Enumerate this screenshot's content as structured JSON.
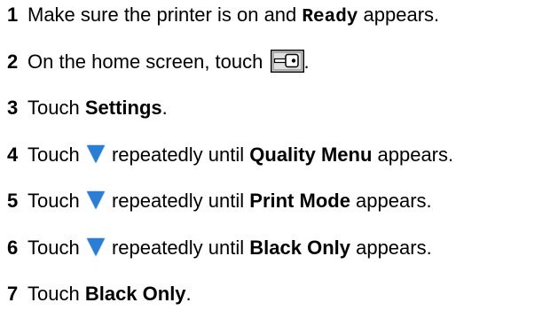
{
  "steps": [
    {
      "number": "1",
      "a": "Make sure the printer is on and ",
      "code": "Ready",
      "b": " appears."
    },
    {
      "number": "2",
      "a": "On the home screen, touch ",
      "icon": "settings-key-icon",
      "b": "."
    },
    {
      "number": "3",
      "a": "Touch ",
      "bold": "Settings",
      "b": "."
    },
    {
      "number": "4",
      "a": "Touch ",
      "icon": "down-arrow-icon",
      "mid": " repeatedly until ",
      "bold": "Quality Menu",
      "b": " appears."
    },
    {
      "number": "5",
      "a": "Touch ",
      "icon": "down-arrow-icon",
      "mid": " repeatedly until ",
      "bold": "Print Mode",
      "b": " appears."
    },
    {
      "number": "6",
      "a": "Touch ",
      "icon": "down-arrow-icon",
      "mid": " repeatedly until ",
      "bold": "Black Only",
      "b": " appears."
    },
    {
      "number": "7",
      "a": "Touch ",
      "bold": "Black Only",
      "b": "."
    }
  ],
  "colors": {
    "arrow": "#2a7fd4",
    "text": "#000000"
  }
}
